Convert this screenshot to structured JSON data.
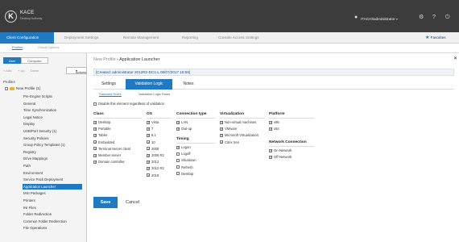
{
  "header": {
    "logo_letter": "K",
    "brand": "KACE",
    "brand_sub": "Desktop Authority",
    "user": "ITACHI\\administrator",
    "user_caret": "▾",
    "icons": [
      "gear-icon",
      "question-icon",
      "power-icon"
    ]
  },
  "nav": {
    "items": [
      "Client Configuration",
      "Deployment Settings",
      "Remote Management",
      "Reporting",
      "Console Access Settings"
    ],
    "favorites": "Favorites"
  },
  "subnav": {
    "items": [
      "Profiles",
      "Global Options"
    ]
  },
  "sidebar": {
    "toggles": [
      "User",
      "Computer"
    ],
    "tools": [
      "+ Add",
      "+ Up",
      "Down"
    ],
    "actions": "Actions",
    "section": "Profiles",
    "profile": "New Profile (1)",
    "items": [
      "Pre-Engine Scripts",
      "General",
      "Time Synchronization",
      "Legal Notice",
      "Display",
      "USB/Port Security (1)",
      "Security Policies",
      "Group Policy Templates (1)",
      "Registry",
      "Drive Mappings",
      "Path",
      "Environment",
      "Service Pack Deployment",
      "Application Launcher",
      "MSI Packages",
      "Printers",
      "INI Files",
      "Folder Redirection",
      "Common Folder Redirection",
      "File Operations"
    ],
    "selected_index": 13
  },
  "main": {
    "crumb_root": "New Profile",
    "crumb_sep": " › ",
    "crumb_current": "Application Launcher",
    "created": "[Created: administrator 2012R2-DC1-L 08/07/2017 15:59]",
    "tabs": [
      "Settings",
      "Validation Logic",
      "Notes"
    ],
    "active_tab": 1,
    "subtabs": [
      "Standard Rules",
      "Validation Logic Rules"
    ],
    "disable_label": "Disable this element regardless of validation",
    "class": {
      "title": "Class",
      "items": [
        {
          "label": "Desktop",
          "checked": true
        },
        {
          "label": "Portable",
          "checked": true
        },
        {
          "label": "Tablet",
          "checked": true
        },
        {
          "label": "Embedded",
          "checked": true
        },
        {
          "label": "Terminal Server client",
          "checked": true
        },
        {
          "label": "Member server",
          "checked": true
        },
        {
          "label": "Domain controller",
          "checked": true
        }
      ]
    },
    "os": {
      "title": "OS",
      "items": [
        {
          "label": "Vista",
          "checked": true
        },
        {
          "label": "7",
          "checked": true
        },
        {
          "label": "8.1",
          "checked": true
        },
        {
          "label": "10",
          "checked": true
        },
        {
          "label": "2008",
          "checked": true
        },
        {
          "label": "2008 R2",
          "checked": true
        },
        {
          "label": "2012",
          "checked": true
        },
        {
          "label": "2012 R2",
          "checked": true
        },
        {
          "label": "2016",
          "checked": true
        }
      ]
    },
    "connection": {
      "title": "Connection type",
      "items": [
        {
          "label": "LAN",
          "checked": true
        },
        {
          "label": "Dial-up",
          "checked": true
        }
      ]
    },
    "timing": {
      "title": "Timing",
      "items": [
        {
          "label": "Logon",
          "checked": true
        },
        {
          "label": "Logoff",
          "checked": false
        },
        {
          "label": "Shutdown",
          "checked": false
        },
        {
          "label": "Refresh",
          "checked": false
        },
        {
          "label": "Desktop",
          "checked": false
        }
      ]
    },
    "virtualization": {
      "title": "Virtualization",
      "items": [
        {
          "label": "Non-virtual machines",
          "checked": true
        },
        {
          "label": "VMware",
          "checked": true
        },
        {
          "label": "Microsoft Virtualization",
          "checked": true
        },
        {
          "label": "Citrix Xen",
          "checked": true
        }
      ]
    },
    "platform": {
      "title": "Platform",
      "items": [
        {
          "label": "x86",
          "checked": true
        },
        {
          "label": "x64",
          "checked": true
        }
      ]
    },
    "network": {
      "title": "Network Connection",
      "items": [
        {
          "label": "On-Network",
          "checked": true
        },
        {
          "label": "Off-Network",
          "checked": true
        }
      ]
    },
    "save": "Save",
    "cancel": "Cancel"
  },
  "colors": {
    "accent": "#1f7ac2",
    "topbar": "#3c3c3c",
    "folder": "#e6b433"
  }
}
